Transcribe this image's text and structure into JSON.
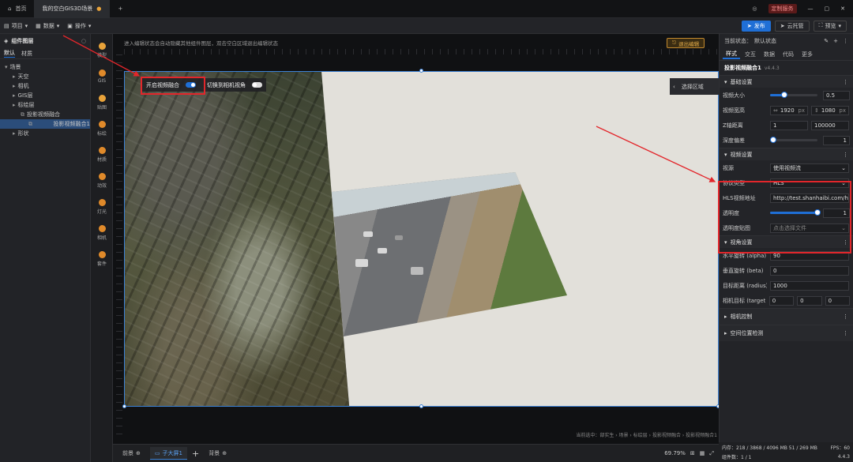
{
  "titlebar": {
    "home_tab": "首页",
    "scene_tab": "我的空白GIS3D场景",
    "plus": "+",
    "custom_badge": "定制服务"
  },
  "toolbar": {
    "project": "项目",
    "data": "数据",
    "operate": "操作",
    "publish": "发布",
    "cloud": "云托管",
    "preview": "预览"
  },
  "layers": {
    "title": "组件图层",
    "tabs": [
      "默认",
      "材质"
    ],
    "items": [
      {
        "label": "场景",
        "indent": 0,
        "sel": false
      },
      {
        "label": "天空",
        "indent": 1,
        "sel": false
      },
      {
        "label": "相机",
        "indent": 1,
        "sel": false
      },
      {
        "label": "GIS层",
        "indent": 1,
        "sel": false
      },
      {
        "label": "标绘层",
        "indent": 1,
        "sel": false
      },
      {
        "label": "投影视频融合",
        "indent": 2,
        "sel": false
      },
      {
        "label": "投影视频融合1",
        "indent": 3,
        "sel": true
      },
      {
        "label": "形状",
        "indent": 1,
        "sel": false
      }
    ]
  },
  "strip": [
    {
      "label": "模型",
      "color": "#e9a33a"
    },
    {
      "label": "GIS",
      "color": "#e08a2a"
    },
    {
      "label": "贴图",
      "color": "#e9a33a"
    },
    {
      "label": "标绘",
      "color": "#e08a2a"
    },
    {
      "label": "材质",
      "color": "#e08a2a"
    },
    {
      "label": "动效",
      "color": "#e08a2a"
    },
    {
      "label": "灯光",
      "color": "#e08a2a"
    },
    {
      "label": "相机",
      "color": "#e08a2a"
    },
    {
      "label": "套件",
      "color": "#e08a2a"
    }
  ],
  "viewport": {
    "hint": "进入编辑状态会自动隐藏其他组件图层，双击空白区域退出编辑状态",
    "exit": "退出编辑",
    "toggle1": "开启视频融合",
    "toggle2": "切换到相机视角",
    "select_area": "选择区域",
    "breadcrumb": "当前选中：部实生 › 场景 › 标绘层 › 投影视频融合 › 投影视频融合1"
  },
  "bottom": {
    "tab1": "前景",
    "tab2": "子大屏1",
    "tab3": "背景",
    "zoom": "69.79%"
  },
  "right": {
    "status_label": "当前状态：",
    "status_value": "默认状态",
    "tabs": [
      "样式",
      "交互",
      "数据",
      "代码",
      "更多"
    ],
    "component_name": "投影视频融合1",
    "version": "v4.4.3",
    "basic": {
      "title": "基础设置",
      "size_label": "视频大小",
      "size_val": "0.5",
      "size_fill": 0.3,
      "wh_label": "视频宽高",
      "w": "1920",
      "px1": "px",
      "h": "1080",
      "px2": "px",
      "far_label": "Z轴距离",
      "far1": "1",
      "far2": "100000",
      "depth_label": "深度偏差",
      "depth_val": "1",
      "depth_fill": 0.06
    },
    "video": {
      "title": "视频设置",
      "src_label": "视源",
      "src_val": "使用视频流",
      "proto_label": "协议类型",
      "proto_val": "HLS",
      "url_label": "HLS视频地址",
      "url_val": "http://test.shanhaibi.com/hls/road",
      "opacity_label": "透明度",
      "opacity_val": "1",
      "opacity_fill": 1,
      "map_label": "透明度贴图",
      "map_val": "点击选择文件"
    },
    "angle": {
      "title": "视角设置",
      "alpha_label": "水平旋转 (alpha)",
      "alpha_val": "90",
      "beta_label": "垂直旋转 (beta)",
      "beta_val": "0",
      "radius_label": "目标距离 (radius)",
      "radius_val": "1000",
      "target_label": "相机目标 (target)",
      "tx": "0",
      "ty": "0",
      "tz": "0"
    },
    "camctl": "相机控制",
    "spatial": "空间位置检测"
  },
  "status": {
    "mem": "内存：218 / 3868 / 4096 MB   51 / 269 MB",
    "fps": "FPS：60",
    "count": "组件数：1 / 1",
    "ver": "4.4.3"
  }
}
